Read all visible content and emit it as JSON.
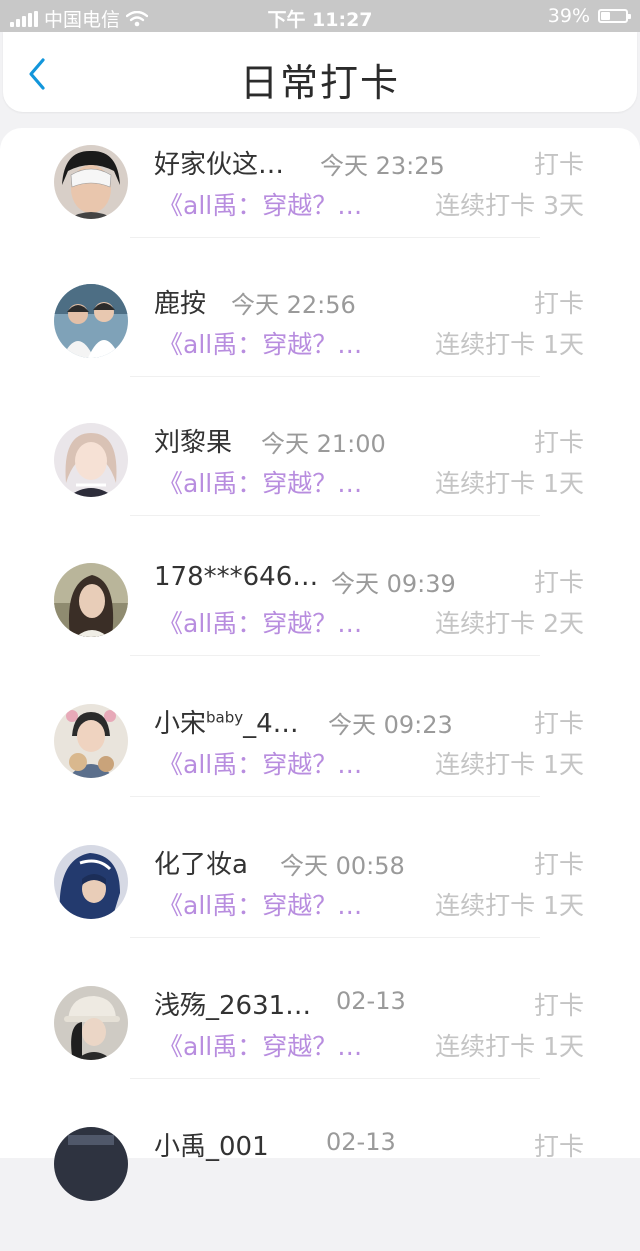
{
  "status_bar": {
    "carrier": "中国电信",
    "time": "下午 11:27",
    "battery_text": "39%",
    "battery_level": 0.39
  },
  "header": {
    "title": "日常打卡"
  },
  "entries": [
    {
      "name": "好家伙这…",
      "time": "今天 23:25",
      "tag": "打卡",
      "book": "《all禹：穿越？…",
      "streak": "连续打卡 3天"
    },
    {
      "name": "鹿按",
      "time": "今天 22:56",
      "tag": "打卡",
      "book": "《all禹：穿越？…",
      "streak": "连续打卡 1天"
    },
    {
      "name": "刘黎果",
      "time": "今天 21:00",
      "tag": "打卡",
      "book": "《all禹：穿越？…",
      "streak": "连续打卡 1天"
    },
    {
      "name": "178***646…",
      "time": "今天 09:39",
      "tag": "打卡",
      "book": "《all禹：穿越？…",
      "streak": "连续打卡 2天"
    },
    {
      "name": "小宋",
      "name_sup": "baby",
      "name_rest": "_4…",
      "time": "今天 09:23",
      "tag": "打卡",
      "book": "《all禹：穿越？…",
      "streak": "连续打卡 1天"
    },
    {
      "name": "化了妆a",
      "time": "今天 00:58",
      "tag": "打卡",
      "book": "《all禹：穿越？…",
      "streak": "连续打卡 1天"
    },
    {
      "name": "浅殇_2631…",
      "time": "02-13",
      "tag": "打卡",
      "book": "《all禹：穿越？…",
      "streak": "连续打卡 1天"
    },
    {
      "name": "小禹_001",
      "time": "02-13",
      "tag": "打卡"
    }
  ],
  "colors": {
    "accent_back": "#1296db",
    "book_text": "#b88ddf",
    "muted_text": "#c4c4c4"
  },
  "icons": [
    "signal-icon",
    "wifi-icon",
    "battery-icon",
    "back-chevron-icon"
  ]
}
